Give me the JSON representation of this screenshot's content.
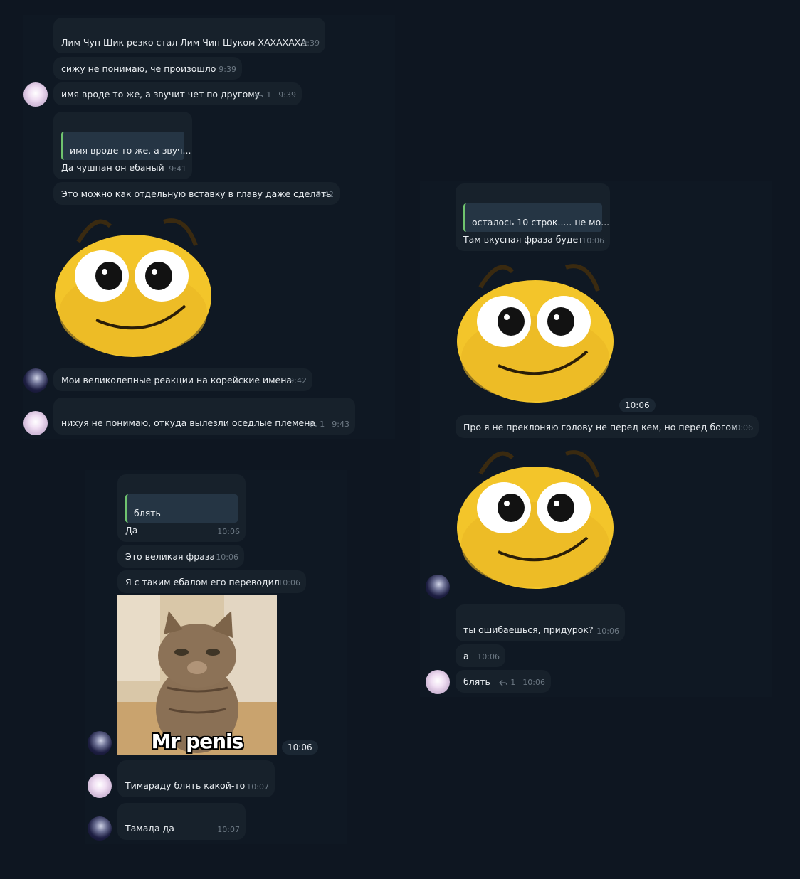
{
  "panels": {
    "left_top": {
      "messages": [
        {
          "text": "Лим Чун Шик резко стал Лим Чин Шуком ХАХАХАХА",
          "time": "9:39"
        },
        {
          "text": "сижу не понимаю, че произошло",
          "time": "9:39"
        },
        {
          "text": "имя вроде то же, а звучит чет по другому",
          "time": "9:39",
          "replies": "1"
        },
        {
          "quote": "имя вроде то же, а звуч...",
          "text": "Да чушпан он ебаный",
          "time": "9:41"
        },
        {
          "text": "Это можно как отдельную вставку в главу даже сделать",
          "time": "9:42"
        },
        {
          "text": "Мои великолепные реакции на корейские имена",
          "time": "9:42"
        },
        {
          "text": "нихуя не понимаю, откуда вылезли оседлые племена",
          "time": "9:43",
          "replies": "1"
        }
      ]
    },
    "right": {
      "messages": [
        {
          "quote": "осталось 10 строк..... не мо...",
          "text": "Там вкусная фраза будет",
          "time": "10:06"
        },
        {
          "sticker_time": "10:06"
        },
        {
          "text": "Про я не преклоняю голову не перед кем, но перед богом",
          "time": "10:06"
        },
        {
          "text": "ты ошибаешься, придурок?",
          "time": "10:06"
        },
        {
          "text": "а",
          "time": "10:06"
        },
        {
          "text": "блять",
          "time": "10:06",
          "replies": "1"
        }
      ]
    },
    "left_bottom": {
      "messages": [
        {
          "quote": "блять",
          "text": "Да",
          "time": "10:06"
        },
        {
          "text": "Это великая фраза",
          "time": "10:06"
        },
        {
          "text": "Я с таким ебалом его переводил",
          "time": "10:06"
        },
        {
          "image_caption": "Mr penis",
          "time": "10:06"
        },
        {
          "text": "Тимараду блять какой-то",
          "time": "10:07"
        },
        {
          "text": "Тамада да",
          "time": "10:07"
        }
      ]
    }
  },
  "colors": {
    "background": "#0e1621",
    "bubble": "#17212b",
    "quote_bar": "#6fc36e",
    "time": "#6c7883"
  }
}
